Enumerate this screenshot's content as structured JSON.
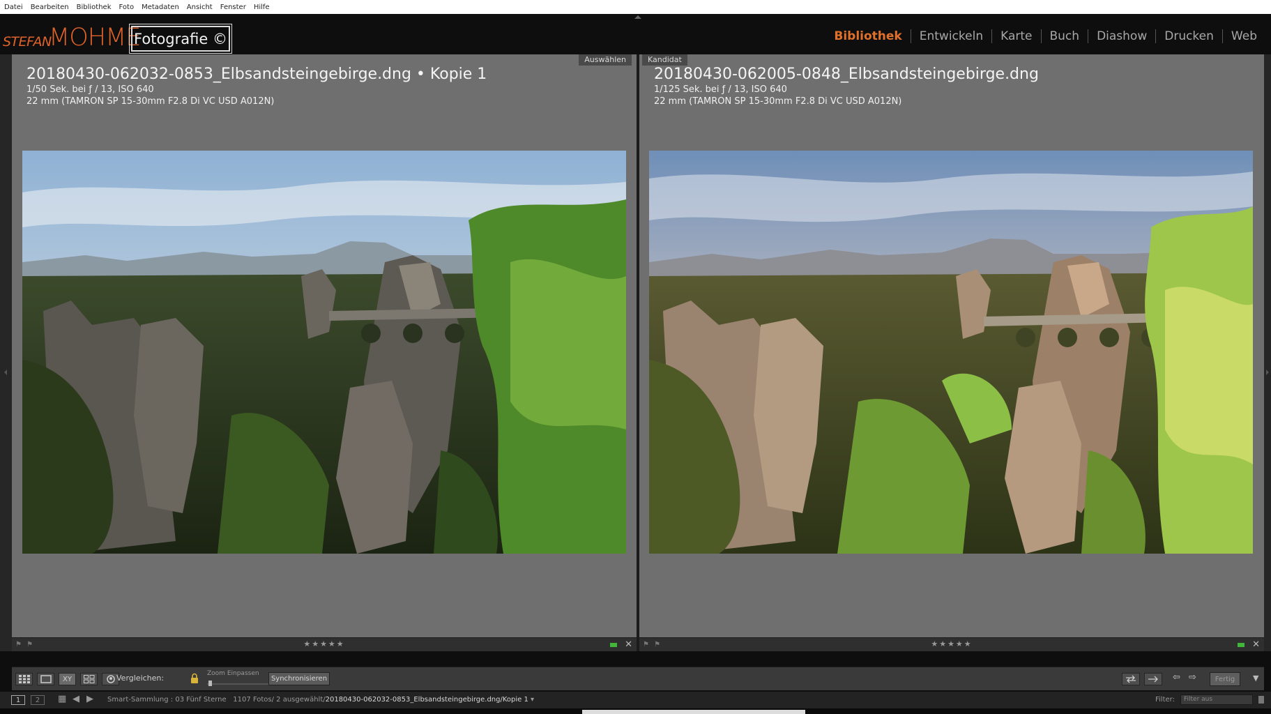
{
  "menu": [
    "Datei",
    "Bearbeiten",
    "Bibliothek",
    "Foto",
    "Metadaten",
    "Ansicht",
    "Fenster",
    "Hilfe"
  ],
  "identity": {
    "first": "STEFAN",
    "last": "MOHME",
    "badge": "Fotografie ©"
  },
  "modules": [
    {
      "label": "Bibliothek",
      "active": true
    },
    {
      "label": "Entwickeln",
      "active": false
    },
    {
      "label": "Karte",
      "active": false
    },
    {
      "label": "Buch",
      "active": false
    },
    {
      "label": "Diashow",
      "active": false
    },
    {
      "label": "Drucken",
      "active": false
    },
    {
      "label": "Web",
      "active": false
    }
  ],
  "panes": {
    "left": {
      "badge": "Auswählen",
      "filename": "20180430-062032-0853_Elbsandsteingebirge.dng • Kopie 1",
      "exposure": "1/50 Sek. bei ƒ / 13, ISO 640",
      "lens": "22 mm (TAMRON SP 15-30mm F2.8 Di VC USD A012N)",
      "stars": "★★★★★"
    },
    "right": {
      "badge": "Kandidat",
      "filename": "20180430-062005-0848_Elbsandsteingebirge.dng",
      "exposure": "1/125 Sek. bei ƒ / 13, ISO 640",
      "lens": "22 mm (TAMRON SP 15-30mm F2.8 Di VC USD A012N)",
      "stars": "★★★★★"
    },
    "close": "✕",
    "flags": "⚑ ⚑"
  },
  "toolbar": {
    "compare_label": "Vergleichen:",
    "zoom_label": "Zoom",
    "zoom_value": "Einpassen",
    "sync_label": "Synchronisieren",
    "done_label": "Fertig",
    "xy_label": "XY"
  },
  "filmstrip": {
    "view1": "1",
    "view2": "2",
    "source_prefix": "Smart-Sammlung : 03 Fünf Sterne",
    "source_count": "1107 Fotos/ 2 ausgewählt/",
    "source_file": "20180430-062032-0853_Elbsandsteingebirge.dng/Kopie 1",
    "source_arrow": "▾",
    "filter_label": "Filter:",
    "filter_value": "Filter aus"
  },
  "colors": {
    "accent": "#e0712c",
    "panel": "#6f6f6f",
    "pick_flag": "#41b73a"
  }
}
